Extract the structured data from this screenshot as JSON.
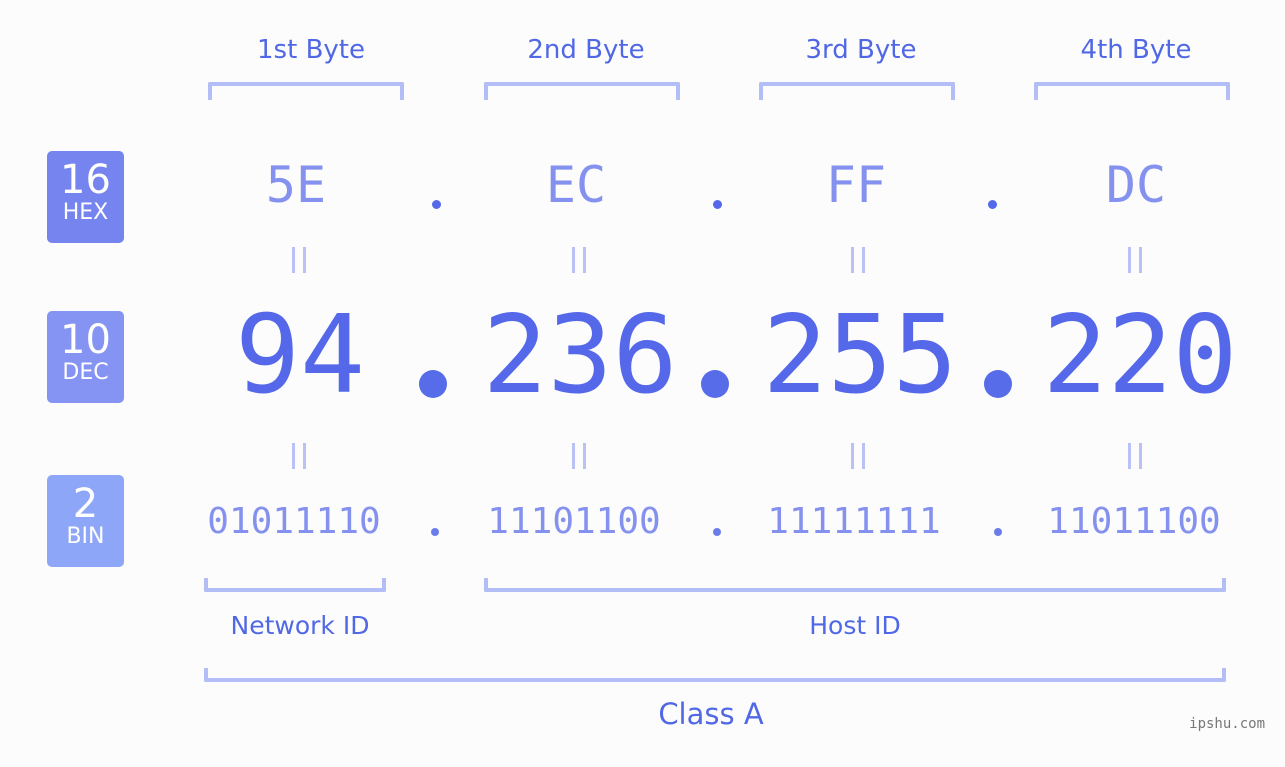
{
  "bytes": [
    {
      "label": "1st Byte",
      "hex": "5E",
      "dec": "94",
      "bin": "01011110"
    },
    {
      "label": "2nd Byte",
      "hex": "EC",
      "dec": "236",
      "bin": "11101100"
    },
    {
      "label": "3rd Byte",
      "hex": "FF",
      "dec": "255",
      "bin": "11111111"
    },
    {
      "label": "4th Byte",
      "hex": "DC",
      "dec": "220",
      "bin": "11011100"
    }
  ],
  "badges": {
    "hex": {
      "number": "16",
      "label": "HEX",
      "color": "#7584ee"
    },
    "dec": {
      "number": "10",
      "label": "DEC",
      "color": "#8593f2"
    },
    "bin": {
      "number": "2",
      "label": "BIN",
      "color": "#8ea6f8"
    }
  },
  "sections": {
    "network_id": "Network ID",
    "host_id": "Host ID",
    "class": "Class A"
  },
  "watermark": "ipshu.com",
  "colors": {
    "accent": "#5568e9",
    "light_accent": "#8591ee",
    "bracket": "#b3bdf6"
  }
}
